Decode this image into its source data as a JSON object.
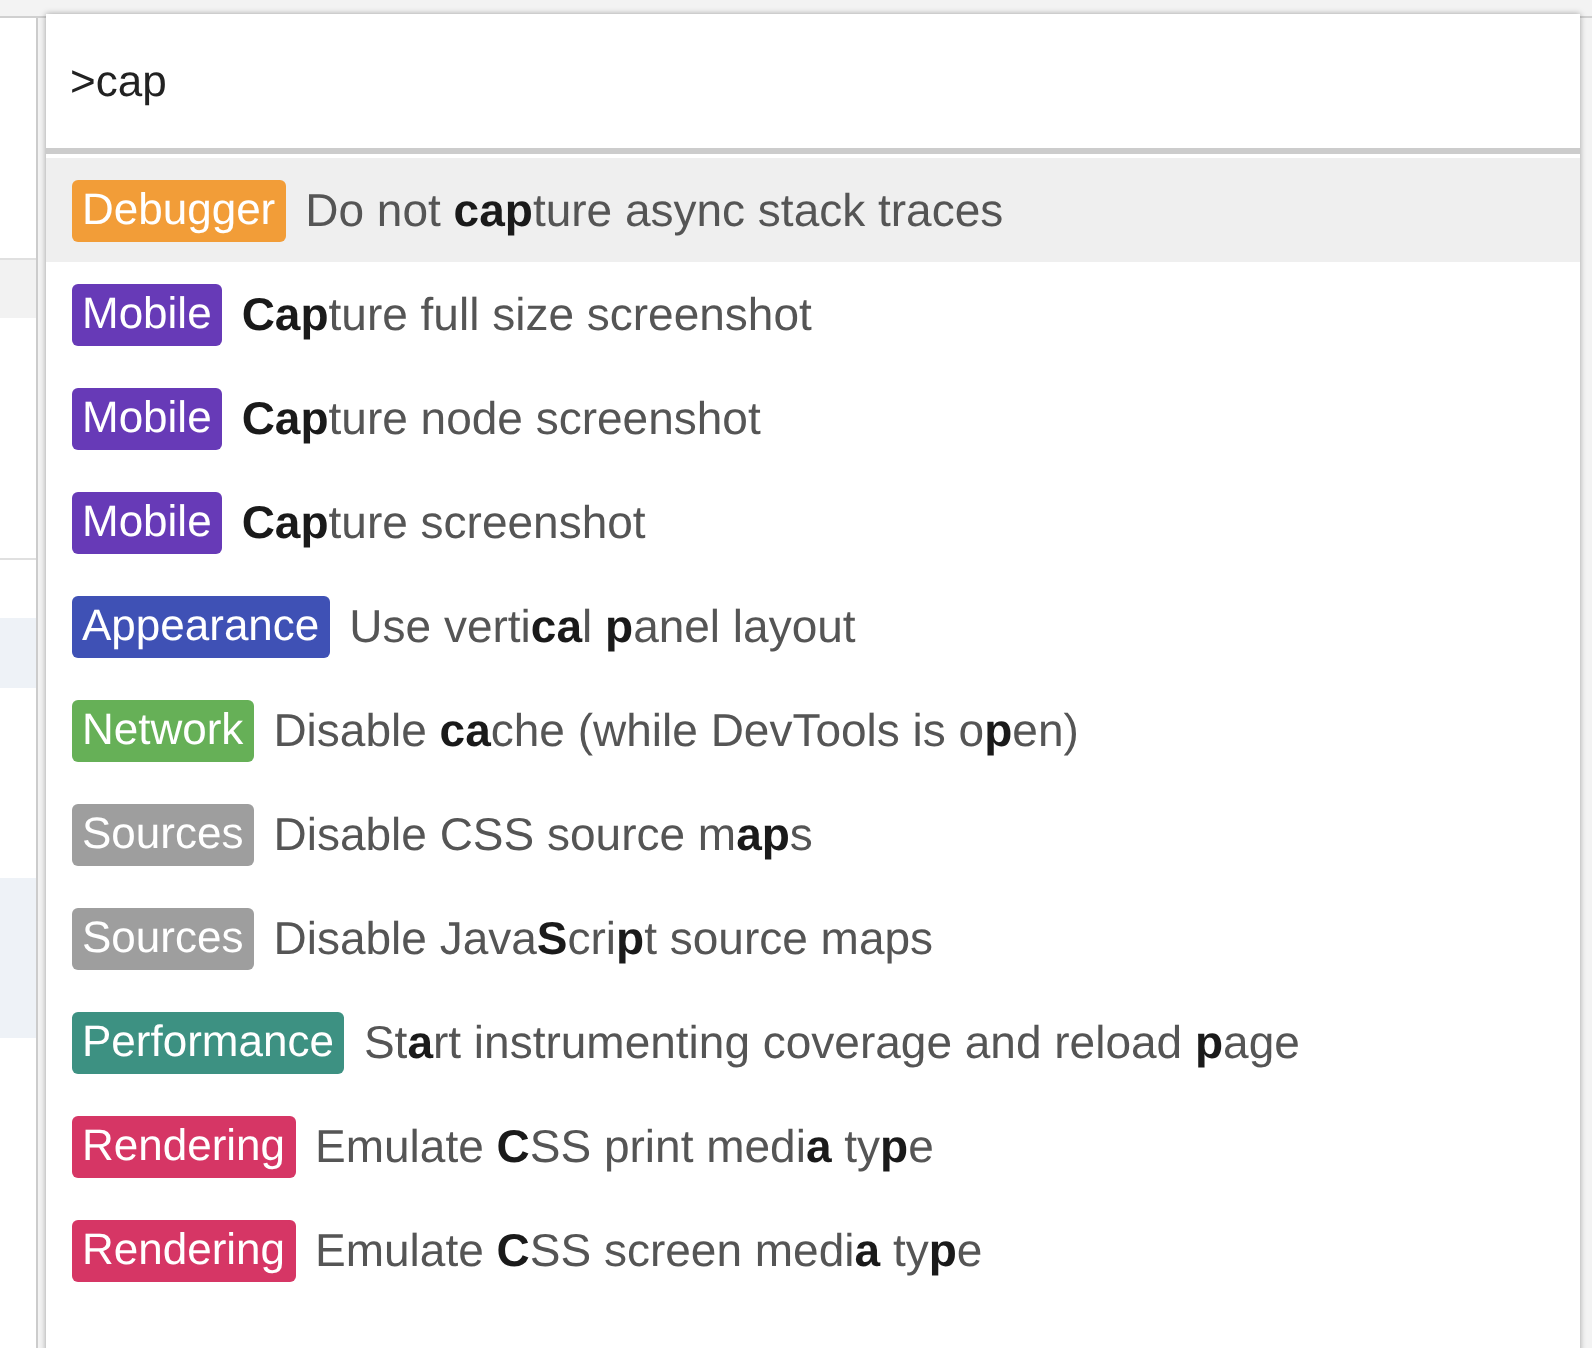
{
  "search": {
    "value": ">cap"
  },
  "commands": [
    {
      "category": "Debugger",
      "color": "#f29d38",
      "text": "Do not **cap**ture async stack traces",
      "selected": true
    },
    {
      "category": "Mobile",
      "color": "#673ab7",
      "text": "**Cap**ture full size screenshot",
      "selected": false
    },
    {
      "category": "Mobile",
      "color": "#673ab7",
      "text": "**Cap**ture node screenshot",
      "selected": false
    },
    {
      "category": "Mobile",
      "color": "#673ab7",
      "text": "**Cap**ture screenshot",
      "selected": false
    },
    {
      "category": "Appearance",
      "color": "#3f51b5",
      "text": "Use verti**ca**l **p**anel layout",
      "selected": false
    },
    {
      "category": "Network",
      "color": "#66b057",
      "text": "Disable **ca**che (while DevTools is o**p**en)",
      "selected": false
    },
    {
      "category": "Sources",
      "color": "#9e9e9e",
      "text": "Disable CSS source m**ap**s",
      "selected": false
    },
    {
      "category": "Sources",
      "color": "#9e9e9e",
      "text": "Disable Java**S**cri**p**t source maps",
      "selected": false
    },
    {
      "category": "Performance",
      "color": "#3d9182",
      "text": "St**a**rt instrumenting coverage and reload **p**age",
      "selected": false
    },
    {
      "category": "Rendering",
      "color": "#d63665",
      "text": "Emulate **C**SS print medi**a** ty**p**e",
      "selected": false
    },
    {
      "category": "Rendering",
      "color": "#d63665",
      "text": "Emulate **C**SS screen medi**a** ty**p**e",
      "selected": false
    }
  ]
}
